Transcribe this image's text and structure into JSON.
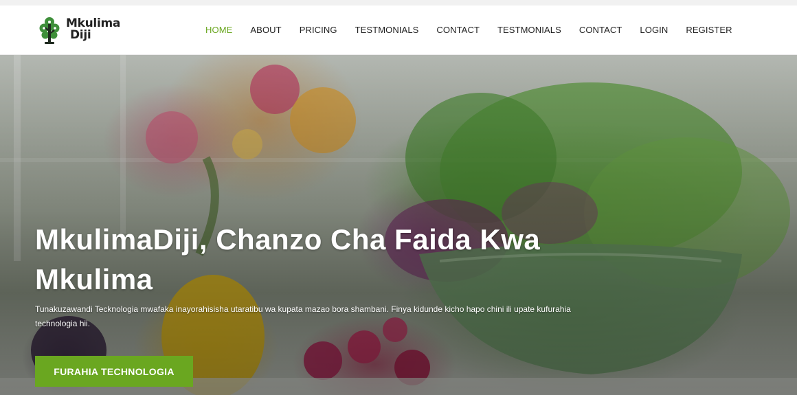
{
  "brand": {
    "line1": "Mkulima",
    "line2": "Diji",
    "logo_icon": "tree-icon",
    "logo_color": "#3e8f3a"
  },
  "nav": {
    "items": [
      {
        "label": "HOME",
        "active": true
      },
      {
        "label": "ABOUT"
      },
      {
        "label": "PRICING"
      },
      {
        "label": "TESTMONIALS"
      },
      {
        "label": "CONTACT"
      },
      {
        "label": "TESTMONIALS"
      },
      {
        "label": "CONTACT"
      },
      {
        "label": "LOGIN"
      },
      {
        "label": "REGISTER"
      }
    ]
  },
  "hero": {
    "title": "MkulimaDiji, Chanzo Cha Faida Kwa Mkulima",
    "subtitle": "Tunakuzawandi Tecknologia mwafaka inayorahisisha utaratibu wa kupata mazao bora shambani. Finya kidunde kicho hapo chini ili upate kufurahia technologia hii.",
    "cta_label": "FURAHIA TECHNOLOGIA",
    "background": "vegetables-photo"
  },
  "colors": {
    "accent": "#6aa720",
    "nav_text": "#222222",
    "hero_text": "#ffffff"
  }
}
